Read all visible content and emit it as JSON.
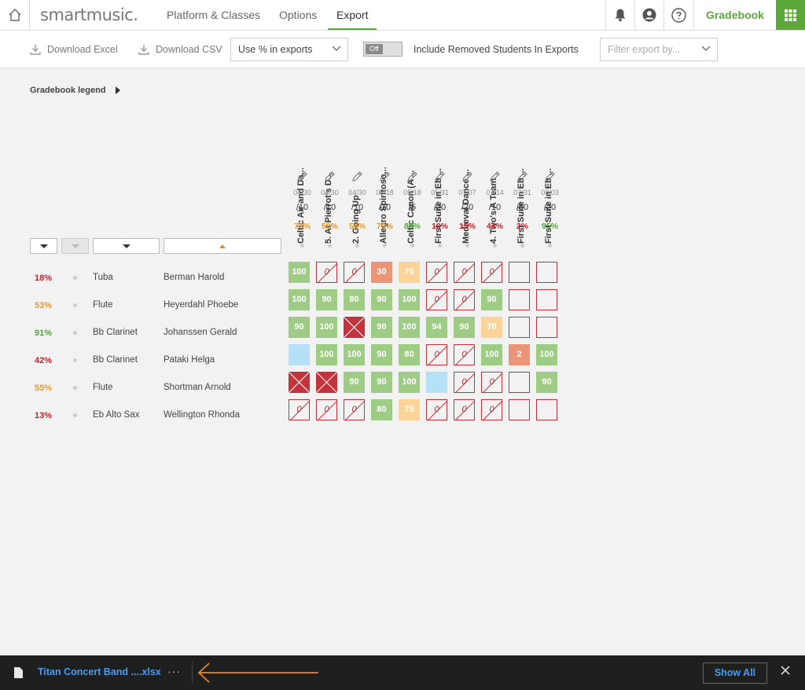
{
  "app": {
    "logo": "smartmusic.",
    "nav_tabs": [
      "Platform & Classes",
      "Options",
      "Export"
    ],
    "active_tab": "Export",
    "section_title": "Gradebook",
    "accent_color": "#5ca83b"
  },
  "toolbar": {
    "download_excel": "Download Excel",
    "download_csv": "Download CSV",
    "export_format_value": "Use % in exports",
    "toggle_state": "Off",
    "toggle_label": "Include Removed Students In Exports",
    "filter_placeholder": "Filter export by..."
  },
  "legend": {
    "label": "Gradebook legend"
  },
  "assignments": [
    {
      "title": "Celtic Air and Da...",
      "date": "04/30",
      "max": "/10",
      "avg": "73%",
      "avg_color": "#e8982a"
    },
    {
      "title": "5. At Pierrot's D...",
      "date": "04/30",
      "max": "/10",
      "avg": "58%",
      "avg_color": "#e8982a"
    },
    {
      "title": "2. Going Up",
      "date": "04/30",
      "max": "/10",
      "avg": "54%",
      "avg_color": "#e8982a"
    },
    {
      "title": "Allegro Spiritoso...",
      "date": "05/18",
      "max": "/10",
      "avg": "79%",
      "avg_color": "#e8982a"
    },
    {
      "title": "Celtic Canon (A ...",
      "date": "05/18",
      "max": "/5",
      "avg": "88%",
      "avg_color": "#4ea53a"
    },
    {
      "title": "First Suite in Eb ...",
      "date": "05/31",
      "max": "/20",
      "avg": "19%",
      "avg_color": "#c8202b"
    },
    {
      "title": "Medieval Dance ...",
      "date": "07/07",
      "max": "/20",
      "avg": "15%",
      "avg_color": "#c8202b"
    },
    {
      "title": "4. Two's A Team",
      "date": "07/14",
      "max": "/10",
      "avg": "44%",
      "avg_color": "#c8202b"
    },
    {
      "title": "First Suite in Eb ...",
      "date": "07/31",
      "max": "/50",
      "avg": "2%",
      "avg_color": "#c8202b"
    },
    {
      "title": "First Suite in Eb ...",
      "date": "08/03",
      "max": "/20",
      "avg": "95%",
      "avg_color": "#4ea53a"
    }
  ],
  "students": [
    {
      "pct": "18%",
      "pct_color": "#c8202b",
      "instrument": "Tuba",
      "name": "Berman Harold",
      "scores": [
        {
          "t": "green",
          "v": "100"
        },
        {
          "t": "zero",
          "v": "0"
        },
        {
          "t": "zero",
          "v": "0"
        },
        {
          "t": "salmon",
          "v": "30"
        },
        {
          "t": "orange",
          "v": "70"
        },
        {
          "t": "zero",
          "v": "0"
        },
        {
          "t": "zero",
          "v": "0"
        },
        {
          "t": "zero",
          "v": "0"
        },
        {
          "t": "empty",
          "v": ""
        },
        {
          "t": "empty",
          "v": ""
        }
      ]
    },
    {
      "pct": "53%",
      "pct_color": "#e8982a",
      "instrument": "Flute",
      "name": "Heyerdahl Phoebe",
      "scores": [
        {
          "t": "green",
          "v": "100"
        },
        {
          "t": "green",
          "v": "90"
        },
        {
          "t": "green",
          "v": "80"
        },
        {
          "t": "green",
          "v": "90"
        },
        {
          "t": "green",
          "v": "100"
        },
        {
          "t": "zero",
          "v": "0"
        },
        {
          "t": "zero",
          "v": "0"
        },
        {
          "t": "green",
          "v": "90"
        },
        {
          "t": "empty",
          "v": ""
        },
        {
          "t": "empty",
          "v": ""
        }
      ]
    },
    {
      "pct": "91%",
      "pct_color": "#4ea53a",
      "instrument": "Bb Clarinet",
      "name": "Johanssen Gerald",
      "scores": [
        {
          "t": "green",
          "v": "90"
        },
        {
          "t": "green",
          "v": "100"
        },
        {
          "t": "cross",
          "v": ""
        },
        {
          "t": "green",
          "v": "90"
        },
        {
          "t": "green",
          "v": "100"
        },
        {
          "t": "green",
          "v": "94"
        },
        {
          "t": "green",
          "v": "90"
        },
        {
          "t": "orange",
          "v": "70"
        },
        {
          "t": "empty",
          "v": ""
        },
        {
          "t": "empty",
          "v": ""
        }
      ]
    },
    {
      "pct": "42%",
      "pct_color": "#c8202b",
      "instrument": "Bb Clarinet",
      "name": "Pataki Helga",
      "scores": [
        {
          "t": "blue",
          "v": ""
        },
        {
          "t": "green",
          "v": "100"
        },
        {
          "t": "green",
          "v": "100"
        },
        {
          "t": "green",
          "v": "90"
        },
        {
          "t": "green",
          "v": "80"
        },
        {
          "t": "zero",
          "v": "0"
        },
        {
          "t": "zero",
          "v": "0"
        },
        {
          "t": "green",
          "v": "100"
        },
        {
          "t": "salmon",
          "v": "2"
        },
        {
          "t": "green",
          "v": "100"
        }
      ]
    },
    {
      "pct": "55%",
      "pct_color": "#e8982a",
      "instrument": "Flute",
      "name": "Shortman Arnold",
      "scores": [
        {
          "t": "cross",
          "v": ""
        },
        {
          "t": "cross",
          "v": ""
        },
        {
          "t": "green",
          "v": "90"
        },
        {
          "t": "green",
          "v": "90"
        },
        {
          "t": "green",
          "v": "100"
        },
        {
          "t": "blue",
          "v": ""
        },
        {
          "t": "zero",
          "v": "0"
        },
        {
          "t": "zero",
          "v": "0"
        },
        {
          "t": "empty",
          "v": ""
        },
        {
          "t": "green",
          "v": "90"
        }
      ]
    },
    {
      "pct": "13%",
      "pct_color": "#c8202b",
      "instrument": "Eb Alto Sax",
      "name": "Wellington Rhonda",
      "scores": [
        {
          "t": "zero",
          "v": "0"
        },
        {
          "t": "zero",
          "v": "0"
        },
        {
          "t": "zero",
          "v": "0"
        },
        {
          "t": "green",
          "v": "80"
        },
        {
          "t": "orange",
          "v": "75"
        },
        {
          "t": "zero",
          "v": "0"
        },
        {
          "t": "zero",
          "v": "0"
        },
        {
          "t": "zero",
          "v": "0"
        },
        {
          "t": "empty",
          "v": ""
        },
        {
          "t": "empty",
          "v": ""
        }
      ]
    }
  ],
  "downloads": {
    "file_name": "Titan Concert Band ....xlsx",
    "more": "···",
    "show_all": "Show All"
  }
}
